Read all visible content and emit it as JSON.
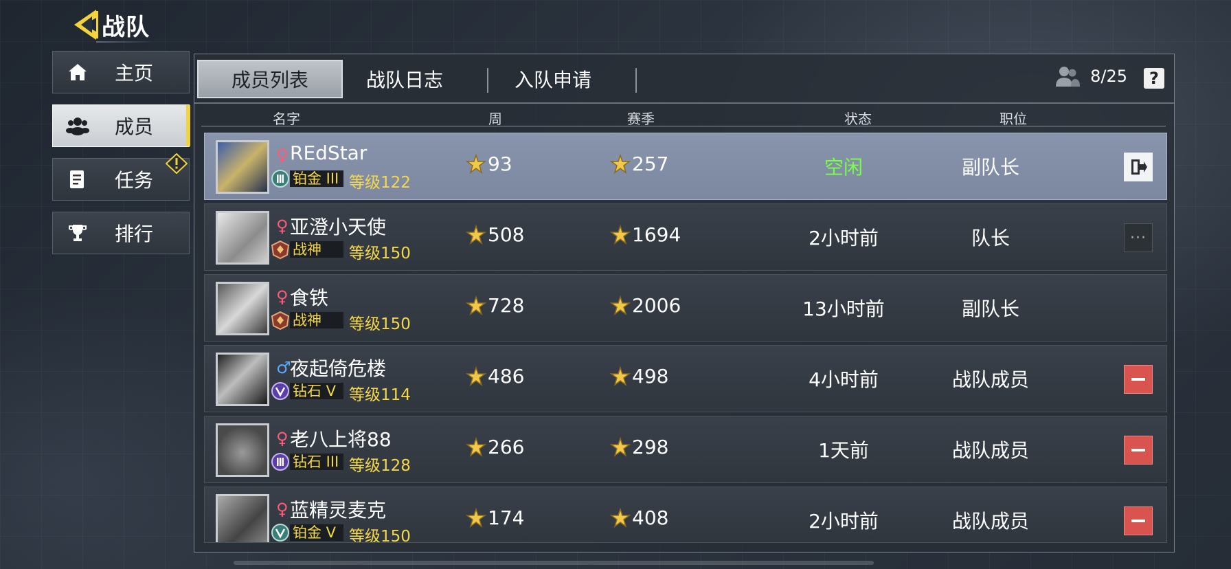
{
  "header": {
    "title": "战队"
  },
  "sidebar": {
    "items": [
      {
        "label": "主页",
        "icon": "home-icon",
        "active": false
      },
      {
        "label": "成员",
        "icon": "members-icon",
        "active": true
      },
      {
        "label": "任务",
        "icon": "task-icon",
        "active": false,
        "badge": "warning-icon"
      },
      {
        "label": "排行",
        "icon": "trophy-icon",
        "active": false
      }
    ]
  },
  "tabs": [
    {
      "label": "成员列表",
      "active": true
    },
    {
      "label": "战队日志",
      "active": false
    },
    {
      "label": "入队申请",
      "active": false
    }
  ],
  "member_count": "8/25",
  "help_label": "?",
  "columns": {
    "name": "名字",
    "week": "周",
    "season": "赛季",
    "status": "状态",
    "role": "职位"
  },
  "members": [
    {
      "name": "REdStar",
      "gender": "♀",
      "rank": "铂金 III",
      "level": "等级122",
      "week": "93",
      "season": "257",
      "status": "空闲",
      "role": "副队长",
      "action": "exit-icon"
    },
    {
      "name": "亚澄小天使",
      "gender": "♀",
      "rank": "战神",
      "level": "等级150",
      "week": "508",
      "season": "1694",
      "status": "2小时前",
      "role": "队长",
      "action": "more-icon",
      "action_label": "···"
    },
    {
      "name": "食铁",
      "gender": "♀",
      "rank": "战神",
      "level": "等级150",
      "week": "728",
      "season": "2006",
      "status": "13小时前",
      "role": "副队长",
      "action": ""
    },
    {
      "name": "夜起倚危楼",
      "gender": "♂",
      "rank": "钻石 V",
      "level": "等级114",
      "week": "486",
      "season": "498",
      "status": "4小时前",
      "role": "战队成员",
      "action": "remove-icon"
    },
    {
      "name": "老八上将88",
      "gender": "♀",
      "rank": "钻石 III",
      "level": "等级128",
      "week": "266",
      "season": "298",
      "status": "1天前",
      "role": "战队成员",
      "action": "remove-icon"
    },
    {
      "name": "蓝精灵麦克",
      "gender": "♀",
      "rank": "铂金 V",
      "level": "等级150",
      "week": "174",
      "season": "408",
      "status": "2小时前",
      "role": "战队成员",
      "action": "remove-icon"
    }
  ],
  "colors": {
    "accent": "#f2d33b",
    "idle": "#78ff48",
    "remove": "#d9534f",
    "female": "#ff5a7a",
    "male": "#5aa8ff"
  }
}
